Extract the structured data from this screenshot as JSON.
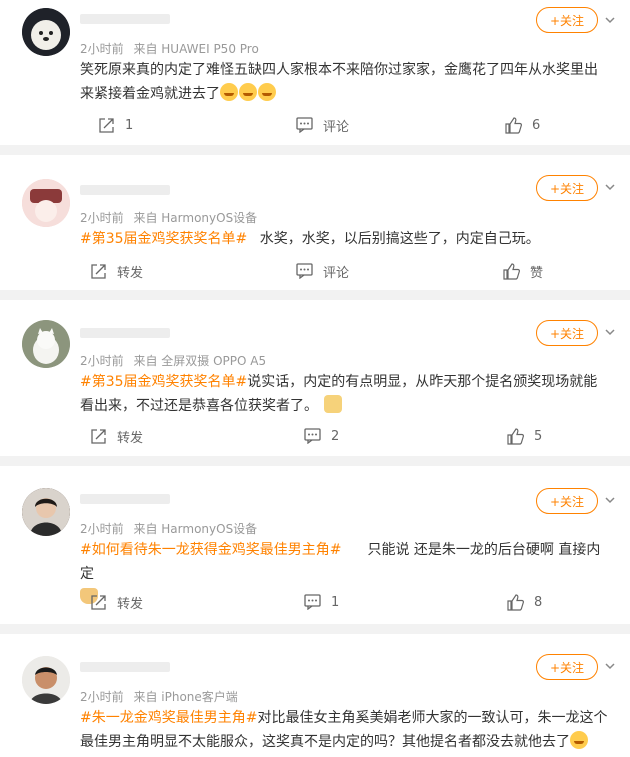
{
  "icons": {
    "share": "share-icon",
    "comment": "comment-icon",
    "like": "like-icon",
    "more": "chevron-down-icon"
  },
  "colors": {
    "accent": "#ff8200",
    "meta": "#999999",
    "background": "#f2f2f2"
  },
  "posts": [
    {
      "time": "2小时前",
      "source": "来自 HUAWEI P50 Pro",
      "follow": "+关注",
      "text": "笑死原来真的内定了难怪五缺四人家根本不来陪你过家家，金鹰花了四年从水奖里出来紧接着金鸡就进去了",
      "share": "1",
      "comment": "评论",
      "like": "6"
    },
    {
      "time": "2小时前",
      "source": "来自 HarmonyOS设备",
      "follow": "+关注",
      "topic": "#第35届金鸡奖获奖名单#",
      "text": "水奖，水奖，以后别搞这些了，内定自己玩。",
      "share": "转发",
      "comment": "评论",
      "like": "赞"
    },
    {
      "time": "2小时前",
      "source": "来自 全屏双摄 OPPO A5",
      "follow": "+关注",
      "topic": "#第35届金鸡奖获奖名单#",
      "text": "说实话，内定的有点明显，从昨天那个提名颁奖现场就能看出来，不过还是恭喜各位获奖者了。",
      "share": "转发",
      "comment": "2",
      "like": "5"
    },
    {
      "time": "2小时前",
      "source": "来自 HarmonyOS设备",
      "follow": "+关注",
      "topic": "#如何看待朱一龙获得金鸡奖最佳男主角#",
      "text": "只能说  还是朱一龙的后台硬啊 直接内定",
      "share": "转发",
      "comment": "1",
      "like": "8"
    },
    {
      "time": "2小时前",
      "source": "来自 iPhone客户端",
      "follow": "+关注",
      "topic": "#朱一龙金鸡奖最佳男主角#",
      "text": "对比最佳女主角奚美娟老师大家的一致认可，朱一龙这个最佳男主角明显不太能服众，这奖真不是内定的吗？其他提名者都没去就他去了"
    }
  ]
}
